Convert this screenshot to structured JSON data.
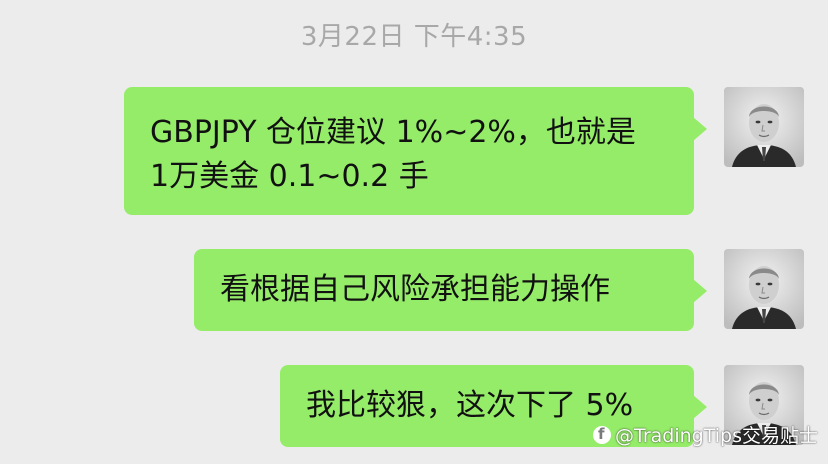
{
  "timestamp": "3月22日 下午4:35",
  "messages": [
    {
      "lines": [
        "GBPJPY 仓位建议 1%~2%，也就是",
        "1万美金 0.1~0.2 手"
      ],
      "sender": "self"
    },
    {
      "lines": [
        "看根据自己风险承担能力操作"
      ],
      "sender": "self"
    },
    {
      "lines": [
        "我比较狠，这次下了 5%"
      ],
      "sender": "self"
    }
  ],
  "colors": {
    "background": "#ececec",
    "bubble": "#95ec69",
    "timestamp": "#a8a8a8"
  },
  "watermark": {
    "text": "@TradingTips交易贴士",
    "icon": "platform-logo-icon"
  }
}
